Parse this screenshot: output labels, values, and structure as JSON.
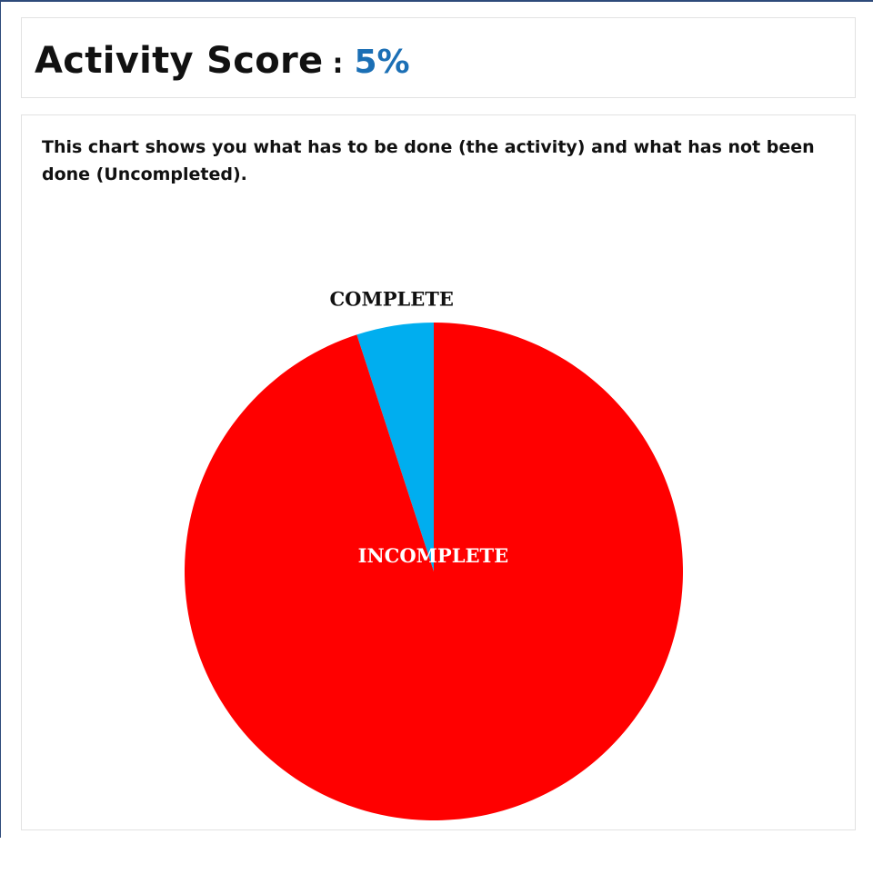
{
  "score": {
    "label": "Activity Score",
    "separator": ":",
    "value": "5%"
  },
  "description": "This chart shows you what has to be done (the activity) and what has not been done (Uncompleted).",
  "chart_data": {
    "type": "pie",
    "title": "",
    "slices": [
      {
        "label": "COMPLETE",
        "value": 5,
        "color": "#00aeef",
        "label_color": "#111111"
      },
      {
        "label": "INCOMPLETE",
        "value": 95,
        "color": "#ff0000",
        "label_color": "#ffffff"
      }
    ],
    "start_angle_deg": 0,
    "direction": "counterclockwise"
  }
}
